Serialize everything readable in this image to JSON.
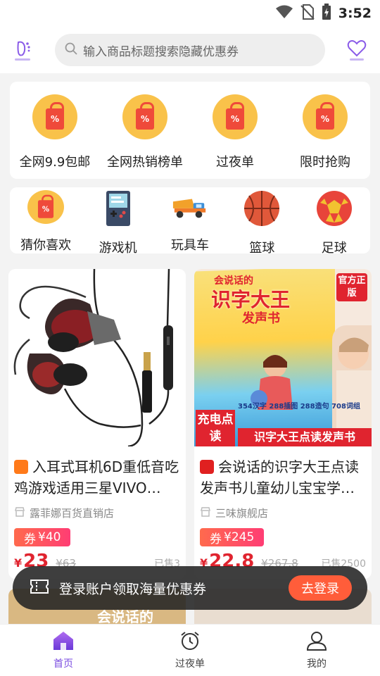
{
  "status_bar": {
    "time": "3:52"
  },
  "search": {
    "placeholder": "输入商品标题搜索隐藏优惠券"
  },
  "categories_top": [
    {
      "label": "全网9.9包邮",
      "icon": "shopping-bag-icon"
    },
    {
      "label": "全网热销榜单",
      "icon": "shopping-bag-icon"
    },
    {
      "label": "过夜单",
      "icon": "shopping-bag-icon"
    },
    {
      "label": "限时抢购",
      "icon": "shopping-bag-icon"
    }
  ],
  "categories_bottom": [
    {
      "label": "猜你喜欢",
      "icon": "shopping-bag-icon"
    },
    {
      "label": "游戏机",
      "icon": "game-console-icon"
    },
    {
      "label": "玩具车",
      "icon": "toy-truck-icon"
    },
    {
      "label": "篮球",
      "icon": "basketball-icon"
    },
    {
      "label": "足球",
      "icon": "football-icon"
    }
  ],
  "products": [
    {
      "title": "入耳式耳机6D重低音吃鸡游戏适用三星VIVO…",
      "shop": "露菲娜百货直销店",
      "coupon_label": "券",
      "coupon_value": "¥40",
      "price_symbol": "¥",
      "price": "23",
      "original_price": "¥63",
      "sold": "已售3",
      "badge_color": "#ff7a1a"
    },
    {
      "title": "会说话的识字大王点读发声书儿童幼儿宝宝学…",
      "shop": "三味旗舰店",
      "coupon_label": "券",
      "coupon_value": "¥245",
      "price_symbol": "¥",
      "price": "22.8",
      "original_price": "¥267.8",
      "sold": "已售2500",
      "badge_color": "#e02020",
      "image_text": {
        "book_title": "识字大王",
        "book_top": "会说话的",
        "book_sub": "发声书",
        "official": "官方正版",
        "charge": "充电点读",
        "banner": "识字大王点读发声书",
        "stats": "354汉字 288插图 288造句 708词组"
      }
    }
  ],
  "peek_text": "会说话的",
  "toast": {
    "message": "登录账户领取海量优惠券",
    "button": "去登录"
  },
  "tabs": [
    {
      "label": "首页",
      "active": true
    },
    {
      "label": "过夜单",
      "active": false
    },
    {
      "label": "我的",
      "active": false
    }
  ],
  "colors": {
    "accent": "#7b4de0",
    "price": "#e0242f",
    "coupon": "#ff3d74"
  }
}
